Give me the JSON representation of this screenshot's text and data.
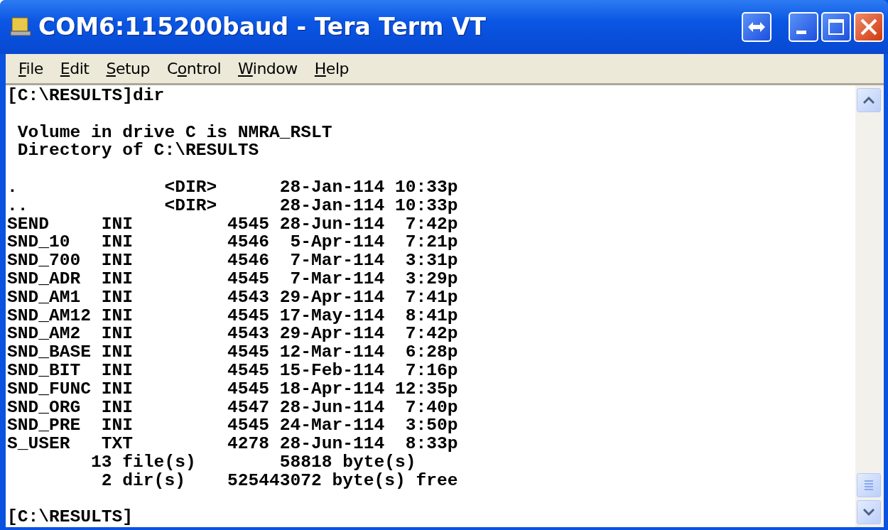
{
  "window": {
    "title": "COM6:115200baud - Tera Term VT"
  },
  "menu": [
    {
      "access_key": "F",
      "rest": "ile"
    },
    {
      "access_key": "E",
      "rest": "dit"
    },
    {
      "access_key": "S",
      "rest": "etup"
    },
    {
      "before": "C",
      "access_key": "o",
      "rest": "ntrol"
    },
    {
      "access_key": "W",
      "rest": "indow"
    },
    {
      "access_key": "H",
      "rest": "elp"
    }
  ],
  "terminal": {
    "blocks": [
      [
        "[C:\\RESULTS]dir"
      ],
      [
        " Volume in drive C is NMRA_RSLT",
        " Directory of C:\\RESULTS"
      ],
      [
        ".              <DIR>      28-Jan-114 10:33p",
        "..             <DIR>      28-Jan-114 10:33p",
        "SEND     INI         4545 28-Jun-114  7:42p",
        "SND_10   INI         4546  5-Apr-114  7:21p",
        "SND_700  INI         4546  7-Mar-114  3:31p",
        "SND_ADR  INI         4545  7-Mar-114  3:29p",
        "SND_AM1  INI         4543 29-Apr-114  7:41p",
        "SND_AM12 INI         4545 17-May-114  8:41p",
        "SND_AM2  INI         4543 29-Apr-114  7:42p",
        "SND_BASE INI         4545 12-Mar-114  6:28p",
        "SND_BIT  INI         4545 15-Feb-114  7:16p",
        "SND_FUNC INI         4545 18-Apr-114 12:35p",
        "SND_ORG  INI         4547 28-Jun-114  7:40p",
        "SND_PRE  INI         4545 24-Mar-114  3:50p",
        "S_USER   TXT         4278 28-Jun-114  8:33p",
        "        13 file(s)        58818 byte(s)",
        "         2 dir(s)    525443072 byte(s) free"
      ],
      [
        "[C:\\RESULTS]"
      ]
    ]
  }
}
